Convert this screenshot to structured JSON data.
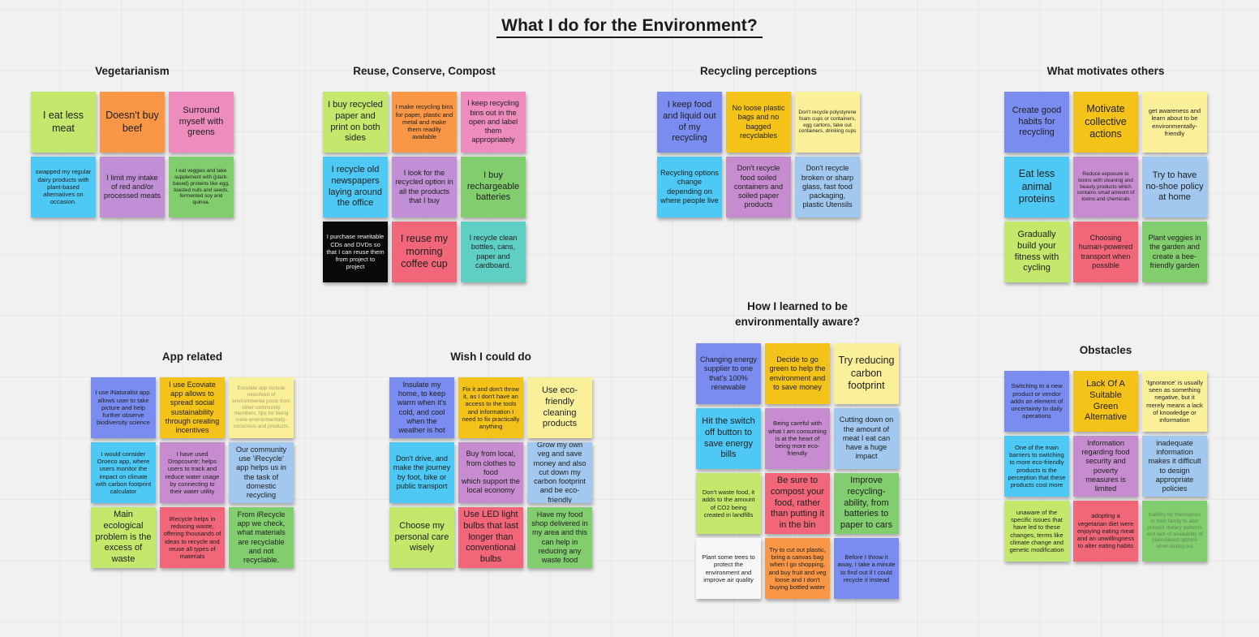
{
  "title": "What I do for the Environment?",
  "palette": {
    "green": "#c4e86b",
    "orange": "#f99746",
    "pink": "#ee8cbd",
    "cyan": "#4ec9f5",
    "purple": "#c08fd6",
    "leaf": "#82ce6f",
    "black": "#090909",
    "red": "#f2667a",
    "teal": "#5fcfc4",
    "periwinkle": "#7a8cf0",
    "gold": "#f4c31a",
    "paleyellow": "#faf09a",
    "skyblue": "#a2c8f0",
    "orchid": "#c78cd0",
    "white": "#f7f7f7"
  },
  "clusters": [
    {
      "id": "vegetarianism",
      "title": "Vegetarianism",
      "notes": [
        {
          "text": "I eat less meat",
          "color": "green",
          "size": "t-xl"
        },
        {
          "text": "Doesn't buy beef",
          "color": "orange",
          "size": "t-xl"
        },
        {
          "text": "Surround myself with greens",
          "color": "pink",
          "size": "t-lg"
        },
        {
          "text": "swapped my regular dairy products with plant-based alternatives on occasion.",
          "color": "cyan",
          "size": "t-sm"
        },
        {
          "text": "I limit my intake of red and/or processed meats",
          "color": "purple",
          "size": "t-md"
        },
        {
          "text": "I eat veggies and take supplement with (plant-based) proteins like egg, toasted nuts and seeds, fermented soy and quinoa.",
          "color": "leaf",
          "size": "t-xs"
        }
      ]
    },
    {
      "id": "reuse-conserve-compost",
      "title": "Reuse, Conserve, Compost",
      "notes": [
        {
          "text": "I buy recycled paper and print on both sides",
          "color": "green",
          "size": "t-lg"
        },
        {
          "text": "I make recycling bins for paper, plastic and metal and make them readily available",
          "color": "orange",
          "size": "t-sm"
        },
        {
          "text": "I keep recycling bins out in the open and label them appropriately",
          "color": "pink",
          "size": "t-md"
        },
        {
          "text": "I recycle old newspapers laying around the office",
          "color": "cyan",
          "size": "t-lg"
        },
        {
          "text": "I look for the recycled option in all the products that I buy",
          "color": "purple",
          "size": "t-md"
        },
        {
          "text": "I buy rechargeable batteries",
          "color": "leaf",
          "size": "t-lg"
        },
        {
          "text": "I purchase rewritable CDs and DVDs so that I can reuse them from project to project",
          "color": "black",
          "size": "t-sm",
          "invert": true
        },
        {
          "text": "I reuse my morning coffee cup",
          "color": "red",
          "size": "t-xl"
        },
        {
          "text": "I recycle clean bottles, cans, paper and cardboard.",
          "color": "teal",
          "size": "t-md"
        }
      ]
    },
    {
      "id": "recycling-perceptions",
      "title": "Recycling perceptions",
      "notes": [
        {
          "text": "I keep food and liquid out of my recycling",
          "color": "periwinkle",
          "size": "t-lg"
        },
        {
          "text": "No loose plastic bags and no bagged recyclables",
          "color": "gold",
          "size": "t-md"
        },
        {
          "text": "Don't recycle polystyrene foam cups or containers, egg cartons, take out containers, drinking cups",
          "color": "paleyellow",
          "size": "t-xs"
        },
        {
          "text": "Recycling options change depending on where people live",
          "color": "cyan",
          "size": "t-md"
        },
        {
          "text": "Don't recycle food soiled containers and soiled paper products",
          "color": "orchid",
          "size": "t-md"
        },
        {
          "text": "Don't recycle broken or sharp glass, fast food packaging, plastic Utensils",
          "color": "skyblue",
          "size": "t-md"
        }
      ]
    },
    {
      "id": "what-motivates-others",
      "title": "What motivates others",
      "notes": [
        {
          "text": "Create good habits for recycling",
          "color": "periwinkle",
          "size": "t-lg"
        },
        {
          "text": "Motivate collective actions",
          "color": "gold",
          "size": "t-xl"
        },
        {
          "text": "get awareness and learn about to be environmentally-friendly",
          "color": "paleyellow",
          "size": "t-sm"
        },
        {
          "text": "Eat less animal proteins",
          "color": "cyan",
          "size": "t-xl"
        },
        {
          "text": "Reduce exposure to toxins with cleaning and beauty products which contains small amount of toxins and chemicals",
          "color": "orchid",
          "size": "t-xs"
        },
        {
          "text": "Try to have no-shoe policy at home",
          "color": "skyblue",
          "size": "t-lg"
        },
        {
          "text": "Gradually build your fitness with cycling",
          "color": "green",
          "size": "t-lg"
        },
        {
          "text": "Choosing human-powered transport when possible",
          "color": "red",
          "size": "t-md"
        },
        {
          "text": "Plant veggies in the garden and create a bee-friendly garden",
          "color": "leaf",
          "size": "t-md"
        }
      ]
    },
    {
      "id": "app-related",
      "title": "App related",
      "notes": [
        {
          "text": "I use iNaturalist app. allows user to take picture and help further observe biodiversity science",
          "color": "periwinkle",
          "size": "t-sm"
        },
        {
          "text": "I use Ecoviate app allows to spread social sustainability through creating incentives",
          "color": "gold",
          "size": "t-md"
        },
        {
          "text": "Ecoviate app include newsfeed of environmental posts from other community members, tips for being more environmentally-conscious and products.",
          "color": "paleyellow",
          "size": "t-xs",
          "faded": true
        },
        {
          "text": "I would consider Oroeco app, where users monitor the impact on climate with carbon footprint calculator",
          "color": "cyan",
          "size": "t-sm"
        },
        {
          "text": "I have used Dropcountr; helps users to track and reduce water usage by connecting to their water utility",
          "color": "orchid",
          "size": "t-sm"
        },
        {
          "text": "Our community use 'iRecycle' app helps us in the task of domestic recycling",
          "color": "skyblue",
          "size": "t-md"
        },
        {
          "text": "Main ecological problem is the excess of waste",
          "color": "green",
          "size": "t-lg"
        },
        {
          "text": "iRecycle helps in reducing waste, offering thousands of ideas to recycle and reuse all types of materials",
          "color": "red",
          "size": "t-sm"
        },
        {
          "text": "From iRecycle app we check, what materials are recyclable and not recyclable.",
          "color": "leaf",
          "size": "t-md"
        }
      ]
    },
    {
      "id": "wish-i-could-do",
      "title": "Wish I could do",
      "notes": [
        {
          "text": "Insulate my home, to keep warm when it's cold, and cool when the weather is hot",
          "color": "periwinkle",
          "size": "t-md"
        },
        {
          "text": "Fix it and don't throw it, as I don't have an access to the tools and information I need to fix practically anything",
          "color": "gold",
          "size": "t-sm"
        },
        {
          "text": "Use eco-friendly cleaning products",
          "color": "paleyellow",
          "size": "t-lg"
        },
        {
          "text": "Don't drive, and make the journey by foot, bike or public transport",
          "color": "cyan",
          "size": "t-md"
        },
        {
          "text": "Buy from local, from clothes to food\nwhich support the local economy",
          "color": "orchid",
          "size": "t-md"
        },
        {
          "text": "Grow my own veg and save money and also  cut down my carbon footprint and be eco-friendly",
          "color": "skyblue",
          "size": "t-md"
        },
        {
          "text": "Choose my personal care wisely",
          "color": "green",
          "size": "t-lg"
        },
        {
          "text": "Use LED light bulbs that last longer than conventional bulbs",
          "color": "red",
          "size": "t-lg"
        },
        {
          "text": "Have my food shop delivered in my area and this can help in reducing any waste food",
          "color": "leaf",
          "size": "t-md"
        }
      ]
    },
    {
      "id": "how-i-learned",
      "title": "How I learned to be\nenvironmentally aware?",
      "notes": [
        {
          "text": "Changing energy supplier to one that's 100% renewable",
          "color": "periwinkle",
          "size": "t-md"
        },
        {
          "text": "Decide to go green to help the environment and to save money",
          "color": "gold",
          "size": "t-md"
        },
        {
          "text": "Try reducing carbon footprint",
          "color": "paleyellow",
          "size": "t-xl"
        },
        {
          "text": "Hit the switch off button to save energy bills",
          "color": "cyan",
          "size": "t-lg"
        },
        {
          "text": "Being careful with what I am consuming is at the heart of being more eco-friendly",
          "color": "orchid",
          "size": "t-sm"
        },
        {
          "text": "Cutting down on the amount of meat I eat can have a huge impact",
          "color": "skyblue",
          "size": "t-md"
        },
        {
          "text": "Don't waste food, it adds to the amount of CO2 being created in landfills",
          "color": "green",
          "size": "t-sm"
        },
        {
          "text": "Be sure to compost your food, rather than putting it in the bin",
          "color": "red",
          "size": "t-lg"
        },
        {
          "text": "Improve recycling-ability, from batteries to paper to cars",
          "color": "leaf",
          "size": "t-lg"
        },
        {
          "text": "Plant some trees to protect the environment and improve air quality",
          "color": "white",
          "size": "t-sm"
        },
        {
          "text": "Try to cut out plastic, bring a canvas bag when I go shopping, and buy fruit and veg loose and I don't buying bottled water",
          "color": "orange",
          "size": "t-sm"
        },
        {
          "text": "Before I throw it away, I take a minute to find out if I could recycle it instead",
          "color": "periwinkle",
          "size": "t-sm"
        }
      ]
    },
    {
      "id": "obstacles",
      "title": "Obstacles",
      "notes": [
        {
          "text": "Switching to a new product or vendor adds an element of uncertainty to daily operations",
          "color": "periwinkle",
          "size": "t-sm"
        },
        {
          "text": "Lack Of A Suitable Green Alternative",
          "color": "gold",
          "size": "t-lg"
        },
        {
          "text": "'Ignorance' is usually seen as something negative, but it merely means a lack of knowledge or information",
          "color": "paleyellow",
          "size": "t-sm"
        },
        {
          "text": "One of the main barriers to switching to more eco-friendly products is the perception that these products cost more",
          "color": "cyan",
          "size": "t-sm"
        },
        {
          "text": "Information regarding food security and poverty measures is limited",
          "color": "orchid",
          "size": "t-md"
        },
        {
          "text": "inadequate information makes it difficult to design appropriate policies",
          "color": "skyblue",
          "size": "t-md"
        },
        {
          "text": "unaware of the specific issues that have led to these changes, terms like climate change and genetic modification",
          "color": "green",
          "size": "t-sm"
        },
        {
          "text": "adopting a vegetarian diet were enjoying eating meat and an unwillingness to alter eating habits",
          "color": "red",
          "size": "t-sm"
        },
        {
          "text": "Inability for themselves or their family to alter present dietary patterns and lack of availability of plant-based options when eating out",
          "color": "leaf",
          "size": "t-xs",
          "faded": true
        }
      ]
    }
  ]
}
